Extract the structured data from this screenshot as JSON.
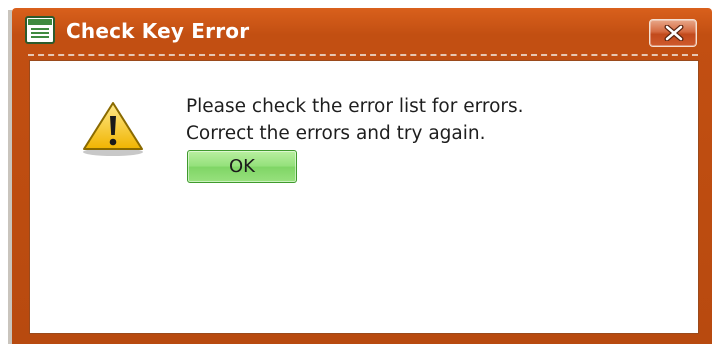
{
  "dialog": {
    "title": "Check Key Error",
    "message_line1": "Please check the error list for errors.",
    "message_line2": "Correct the errors and try again.",
    "ok_label": "OK",
    "title_icon": "window-form-icon",
    "warning_icon": "warning-icon",
    "close_icon": "close-icon"
  },
  "colors": {
    "titlebar": "#c24f12",
    "ok_button": "#93e07a",
    "close_button": "#d56a40",
    "background": "#ffffff"
  }
}
